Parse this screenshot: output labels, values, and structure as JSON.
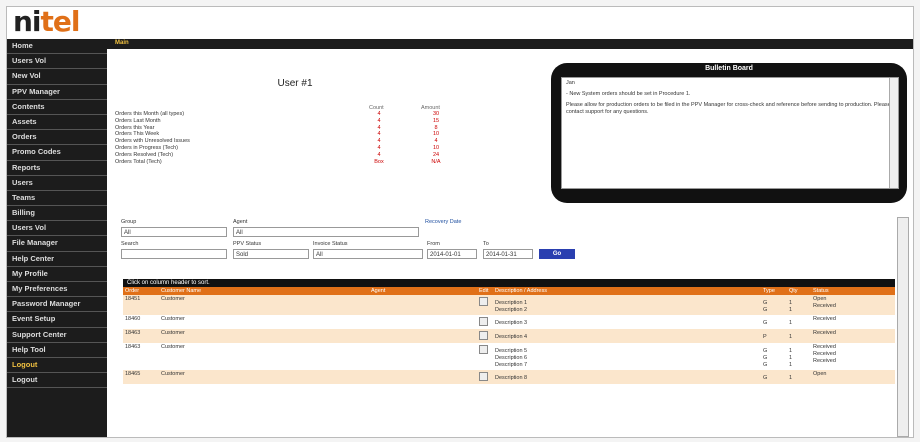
{
  "brand": {
    "part1": "ni",
    "part2": "tel"
  },
  "breadcrumb": "Main",
  "page_title": "User #1",
  "sidebar": {
    "items": [
      {
        "label": "Home"
      },
      {
        "label": "Users Vol"
      },
      {
        "label": "New Vol"
      },
      {
        "label": "PPV Manager"
      },
      {
        "label": "Contents"
      },
      {
        "label": "Assets"
      },
      {
        "label": "Orders"
      },
      {
        "label": "Promo Codes"
      },
      {
        "label": "Reports"
      },
      {
        "label": "Users"
      },
      {
        "label": "Teams"
      },
      {
        "label": "Billing"
      },
      {
        "label": "Users Vol"
      },
      {
        "label": "File Manager"
      },
      {
        "label": "Help Center"
      },
      {
        "label": "My Profile"
      },
      {
        "label": "My Preferences"
      },
      {
        "label": "Password Manager"
      },
      {
        "label": "Event Setup"
      },
      {
        "label": "Support Center"
      },
      {
        "label": "Help Tool"
      },
      {
        "label": "Logout"
      },
      {
        "label": "Logout"
      }
    ]
  },
  "stats": {
    "col1_header": "Count",
    "col2_header": "Amount",
    "rows": [
      {
        "label": "Orders this Month (all types)",
        "c1": "4",
        "c2": "30"
      },
      {
        "label": "Orders Last Month",
        "c1": "4",
        "c2": "15"
      },
      {
        "label": "Orders this Year",
        "c1": "4",
        "c2": "8"
      },
      {
        "label": "Orders This Week",
        "c1": "4",
        "c2": "10"
      },
      {
        "label": "Orders with Unresolved Issues",
        "c1": "4",
        "c2": "4"
      },
      {
        "label": "Orders in Progress (Tech)",
        "c1": "4",
        "c2": "10"
      },
      {
        "label": "Orders Resolved (Tech)",
        "c1": "4",
        "c2": "24"
      },
      {
        "label": "Orders Total (Tech)",
        "c1": "Box",
        "c2": "N/A"
      }
    ]
  },
  "bulletin": {
    "title": "Bulletin Board",
    "lines": [
      "Jan",
      "- New System orders should be set in Procedure 1.",
      "Please allow for production orders to be filed in the PPV Manager for cross-check and reference before sending to production. Please contact support for any questions."
    ]
  },
  "filters": {
    "group_label": "Group",
    "group_value": "All",
    "agent_label": "Agent",
    "agent_value": "All",
    "recovery_label": "Recovery Date",
    "search_label": "Search",
    "search_value": "",
    "ppv_label": "PPV Status",
    "ppv_value": "Sold",
    "invoice_label": "Invoice Status",
    "invoice_value": "All",
    "from_label": "From",
    "from_value": "2014-01-01",
    "to_label": "To",
    "to_value": "2014-01-31",
    "go_label": "Go"
  },
  "table_note": "Click on column header to sort.",
  "table": {
    "headers": [
      "Order",
      "Customer Name",
      "Agent",
      "Edit",
      "Description / Address",
      "Type",
      "Qty",
      "Status"
    ],
    "rows": [
      {
        "order": "18451",
        "customer": "Customer",
        "lines": [
          "Description 1",
          "Description 2"
        ],
        "types": [
          "G",
          "G"
        ],
        "qty": [
          "1",
          "1"
        ],
        "status": [
          "Open",
          "Received"
        ]
      },
      {
        "order": "18460",
        "customer": "Customer",
        "lines": [
          "Description 3"
        ],
        "types": [
          "G"
        ],
        "qty": [
          "1"
        ],
        "status": [
          "Received"
        ]
      },
      {
        "order": "18463",
        "customer": "Customer",
        "lines": [
          "Description 4"
        ],
        "types": [
          "P"
        ],
        "qty": [
          "1"
        ],
        "status": [
          "Received"
        ]
      },
      {
        "order": "18463",
        "customer": "Customer",
        "lines": [
          "Description 5",
          "Description 6",
          "Description 7"
        ],
        "types": [
          "G",
          "G",
          "G"
        ],
        "qty": [
          "1",
          "1",
          "1"
        ],
        "status": [
          "Received",
          "Received",
          "Received"
        ]
      },
      {
        "order": "18465",
        "customer": "Customer",
        "lines": [
          "Description 8"
        ],
        "types": [
          "G"
        ],
        "qty": [
          "1"
        ],
        "status": [
          "Open"
        ]
      }
    ]
  }
}
